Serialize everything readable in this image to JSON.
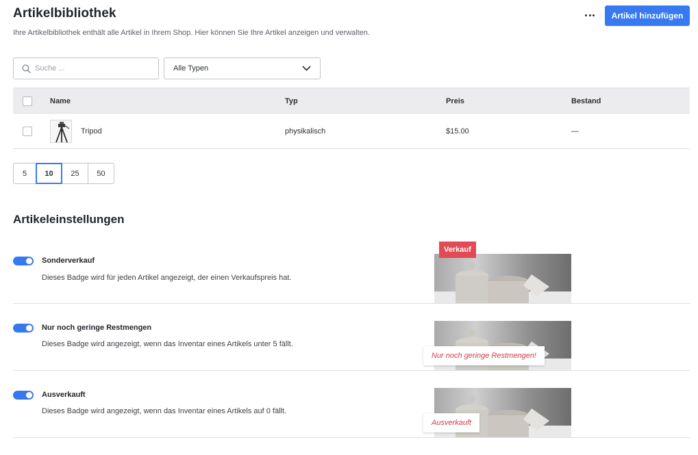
{
  "header": {
    "title": "Artikelbibliothek",
    "subtitle": "Ihre Artikelbibliothek enthält alle Artikel in Ihrem Shop. Hier können Sie Ihre Artikel anzeigen und verwalten.",
    "add_button": "Artikel hinzufügen"
  },
  "filters": {
    "search_placeholder": "Suche ...",
    "type_select": "Alle Typen"
  },
  "table": {
    "columns": [
      "Name",
      "Typ",
      "Preis",
      "Bestand"
    ],
    "rows": [
      {
        "name": "Tripod",
        "type": "physikalisch",
        "price": "$15.00",
        "stock": "—"
      }
    ]
  },
  "pagination": {
    "options": [
      "5",
      "10",
      "25",
      "50"
    ],
    "selected": "10"
  },
  "settings": {
    "title": "Artikeleinstellungen",
    "items": [
      {
        "label": "Sonderverkauf",
        "description": "Dieses Badge wird für jeden Artikel angezeigt, der einen Verkaufspreis hat.",
        "enabled": true,
        "badge": "Verkauf"
      },
      {
        "label": "Nur noch geringe Restmengen",
        "description": "Dieses Badge wird angezeigt, wenn das Inventar eines Artikels unter 5 fällt.",
        "enabled": true,
        "badge": "Nur noch geringe Restmengen!"
      },
      {
        "label": "Ausverkauft",
        "description": "Dieses Badge wird angezeigt, wenn das Inventar eines Artikels auf 0 fällt.",
        "enabled": true,
        "badge": "Ausverkauft"
      }
    ]
  },
  "colors": {
    "accent": "#3779f0",
    "badge_red": "#e04b55",
    "header_bg": "#ececee"
  },
  "icons": {
    "more": "more-horizontal-icon",
    "search": "search-icon",
    "dropdown": "chevron-down-icon"
  }
}
